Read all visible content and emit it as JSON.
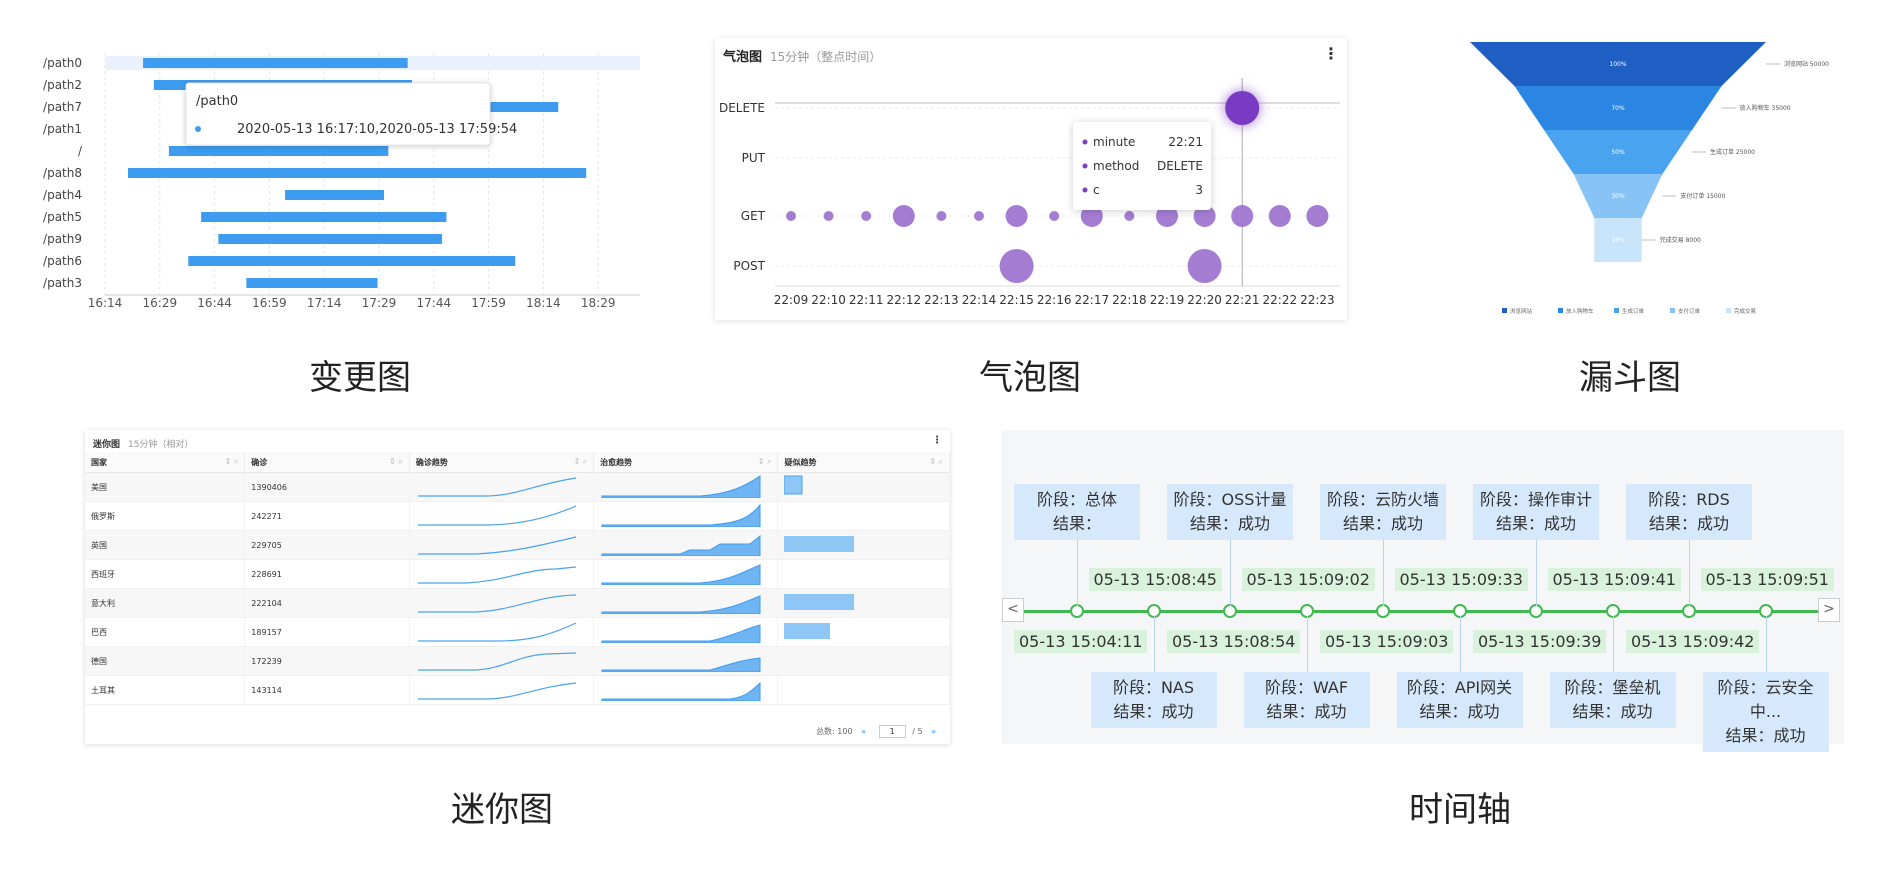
{
  "captions": {
    "change": "变更图",
    "bubble": "气泡图",
    "funnel": "漏斗图",
    "mini": "迷你图",
    "timeline": "时间轴"
  },
  "chart_data": [
    {
      "type": "bar",
      "name": "gantt",
      "categories": [
        "/path0",
        "/path2",
        "/path7",
        "/path1",
        "/",
        "/path8",
        "/path4",
        "/path5",
        "/path9",
        "/path6",
        "/path3"
      ],
      "ranges": [
        [
          16.41,
          17.64
        ],
        [
          16.46,
          17.66
        ],
        [
          17.66,
          18.34
        ],
        [
          null,
          null
        ],
        [
          16.53,
          17.55
        ],
        [
          16.34,
          18.47
        ],
        [
          17.07,
          17.53
        ],
        [
          16.68,
          17.82
        ],
        [
          16.76,
          17.8
        ],
        [
          16.62,
          18.14
        ],
        [
          16.89,
          17.5
        ]
      ],
      "xticks": [
        "16:14",
        "16:29",
        "16:44",
        "16:59",
        "17:14",
        "17:29",
        "17:44",
        "17:59",
        "18:14",
        "18:29"
      ],
      "tooltip": {
        "title": "/path0",
        "value": "2020-05-13 16:17:10,2020-05-13 17:59:54"
      }
    },
    {
      "type": "scatter",
      "name": "bubble",
      "title": "气泡图",
      "subtitle": "15分钟（整点时间）",
      "menu": "⋮",
      "categories": [
        "22:09",
        "22:10",
        "22:11",
        "22:12",
        "22:13",
        "22:14",
        "22:15",
        "22:16",
        "22:17",
        "22:18",
        "22:19",
        "22:20",
        "22:21",
        "22:22",
        "22:23"
      ],
      "yCategories": [
        "DELETE",
        "PUT",
        "GET",
        "POST"
      ],
      "points": [
        {
          "x": "22:09",
          "y": "GET",
          "c": 1
        },
        {
          "x": "22:10",
          "y": "GET",
          "c": 1
        },
        {
          "x": "22:11",
          "y": "GET",
          "c": 1
        },
        {
          "x": "22:12",
          "y": "GET",
          "c": 2
        },
        {
          "x": "22:13",
          "y": "GET",
          "c": 1
        },
        {
          "x": "22:14",
          "y": "GET",
          "c": 1
        },
        {
          "x": "22:15",
          "y": "GET",
          "c": 2
        },
        {
          "x": "22:16",
          "y": "GET",
          "c": 1
        },
        {
          "x": "22:17",
          "y": "GET",
          "c": 2
        },
        {
          "x": "22:18",
          "y": "GET",
          "c": 1
        },
        {
          "x": "22:19",
          "y": "GET",
          "c": 2
        },
        {
          "x": "22:20",
          "y": "GET",
          "c": 2
        },
        {
          "x": "22:21",
          "y": "GET",
          "c": 2
        },
        {
          "x": "22:22",
          "y": "GET",
          "c": 2
        },
        {
          "x": "22:23",
          "y": "GET",
          "c": 2
        },
        {
          "x": "22:15",
          "y": "POST",
          "c": 3
        },
        {
          "x": "22:20",
          "y": "POST",
          "c": 3
        },
        {
          "x": "22:21",
          "y": "DELETE",
          "c": 3
        }
      ],
      "tooltip": {
        "rows": [
          {
            "k": "minute",
            "v": "22:21"
          },
          {
            "k": "method",
            "v": "DELETE"
          },
          {
            "k": "c",
            "v": "3"
          }
        ]
      }
    },
    {
      "type": "funnel",
      "name": "funnel",
      "stages": [
        {
          "label": "100%",
          "name": "浏览网站",
          "value": 50000,
          "note": "浏览网站 50000",
          "color": "#1f5fc4"
        },
        {
          "label": "70%",
          "name": "放入购物车",
          "value": 35000,
          "note": "放入购物车 35000",
          "color": "#2b86e3"
        },
        {
          "label": "50%",
          "name": "生成订单",
          "value": 25000,
          "note": "生成订单 25000",
          "color": "#4aa3ee"
        },
        {
          "label": "30%",
          "name": "支付订单",
          "value": 15000,
          "note": "支付订单 15000",
          "color": "#87c4f5"
        },
        {
          "label": "16%",
          "name": "完成交易",
          "value": 8000,
          "note": "完成交易 8000",
          "color": "#c7e4fb"
        }
      ]
    },
    {
      "type": "table",
      "name": "sparkline-table",
      "title": "迷你图",
      "subtitle": "15分钟（相对）",
      "columns": [
        "国家",
        "确诊",
        "确诊趋势",
        "治愈趋势",
        "疑似趋势"
      ],
      "rows": [
        {
          "country": "美国",
          "confirmed": "1390406"
        },
        {
          "country": "俄罗斯",
          "confirmed": "242271"
        },
        {
          "country": "英国",
          "confirmed": "229705"
        },
        {
          "country": "西班牙",
          "confirmed": "228691"
        },
        {
          "country": "意大利",
          "confirmed": "222104"
        },
        {
          "country": "巴西",
          "confirmed": "189157"
        },
        {
          "country": "德国",
          "confirmed": "172239"
        },
        {
          "country": "土耳其",
          "confirmed": "143114"
        }
      ],
      "footer": {
        "total": "总数: 100",
        "page": "1",
        "pages": "/ 5",
        "prev": "«",
        "next": "»"
      }
    },
    {
      "type": "timeline",
      "name": "timeline",
      "upper": [
        {
          "stage": "阶段：总体",
          "result": "结果：",
          "time": "05-13 15:04:11"
        },
        {
          "stage": "阶段：OSS计量",
          "result": "结果：成功",
          "time": "05-13 15:08:54"
        },
        {
          "stage": "阶段：云防火墙",
          "result": "结果：成功",
          "time": "05-13 15:09:03"
        },
        {
          "stage": "阶段：操作审计",
          "result": "结果：成功",
          "time": "05-13 15:09:39"
        },
        {
          "stage": "阶段：RDS",
          "result": "结果：成功",
          "time": "05-13 15:09:42"
        }
      ],
      "lower": [
        {
          "stage": "阶段：NAS",
          "result": "结果：成功",
          "time": "05-13 15:08:45"
        },
        {
          "stage": "阶段：WAF",
          "result": "结果：成功",
          "time": "05-13 15:09:02"
        },
        {
          "stage": "阶段：API网关",
          "result": "结果：成功",
          "time": "05-13 15:09:33"
        },
        {
          "stage": "阶段：堡垒机",
          "result": "结果：成功",
          "time": "05-13 15:09:41"
        },
        {
          "stage": "阶段：云安全中...",
          "result": "结果：成功",
          "time": "05-13 15:09:51"
        }
      ],
      "nav": {
        "prev": "<",
        "next": ">"
      }
    }
  ]
}
